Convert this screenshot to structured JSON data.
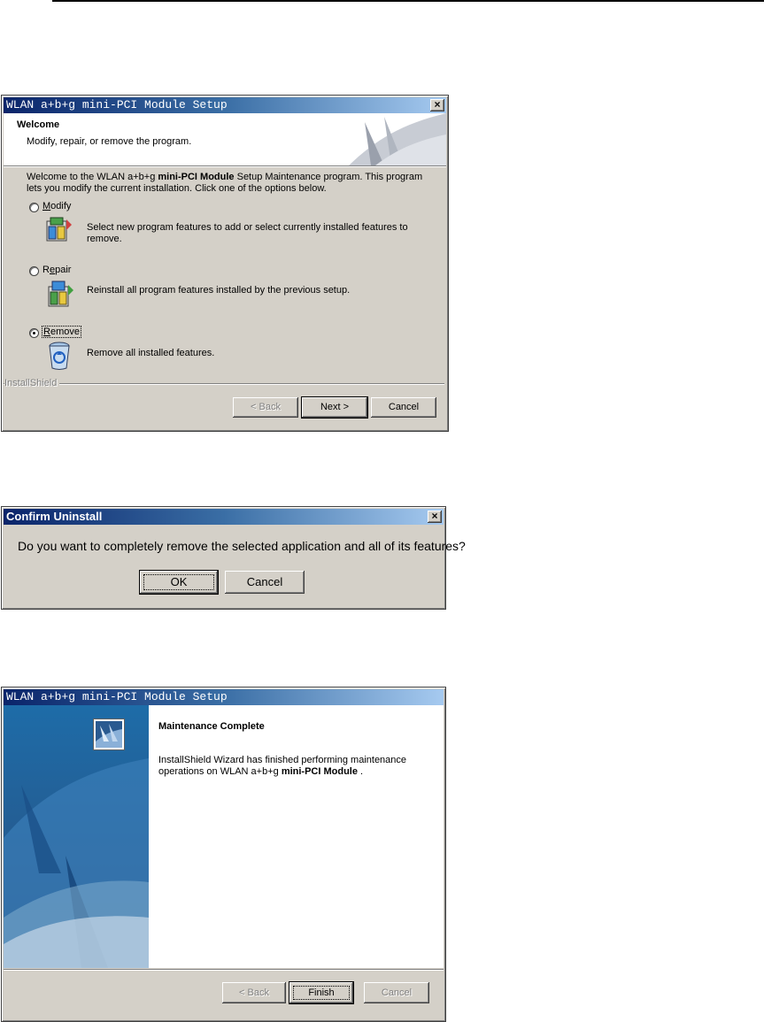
{
  "setup_dialog": {
    "title": "WLAN a+b+g mini-PCI Module Setup",
    "close": "×",
    "header_title": "Welcome",
    "header_subtitle": "Modify, repair, or remove the program.",
    "intro_prefix": "Welcome to the WLAN a+b+g ",
    "intro_bold": "mini-PCI Module",
    "intro_suffix": " Setup Maintenance program. This program lets you modify the current installation. Click one of the options below.",
    "options": [
      {
        "label_pre": "",
        "label_accel": "M",
        "label_post": "odify",
        "description": "Select new program features to add or select currently installed features to remove.",
        "selected": false
      },
      {
        "label_pre": "R",
        "label_accel": "e",
        "label_post": "pair",
        "description": "Reinstall all program features installed by the previous setup.",
        "selected": false
      },
      {
        "label_pre": "",
        "label_accel": "R",
        "label_post": "emove",
        "description": "Remove all installed features.",
        "selected": true
      }
    ],
    "brand": "InstallShield",
    "back_button": "< Back",
    "next_button": "Next >",
    "cancel_button": "Cancel"
  },
  "confirm_dialog": {
    "title": "Confirm Uninstall",
    "close": "×",
    "message": "Do you want to completely remove the selected application and all of its features?",
    "ok_button": "OK",
    "cancel_button": "Cancel"
  },
  "complete_dialog": {
    "title": "WLAN a+b+g mini-PCI Module Setup",
    "heading": "Maintenance Complete",
    "body_line1": "InstallShield Wizard has finished performing maintenance",
    "body_line2_prefix": "operations on WLAN a+b+g ",
    "body_line2_bold": "mini-PCI Module",
    "body_line2_suffix": " .",
    "back_button": "< Back",
    "finish_button": "Finish",
    "cancel_button": "Cancel"
  }
}
